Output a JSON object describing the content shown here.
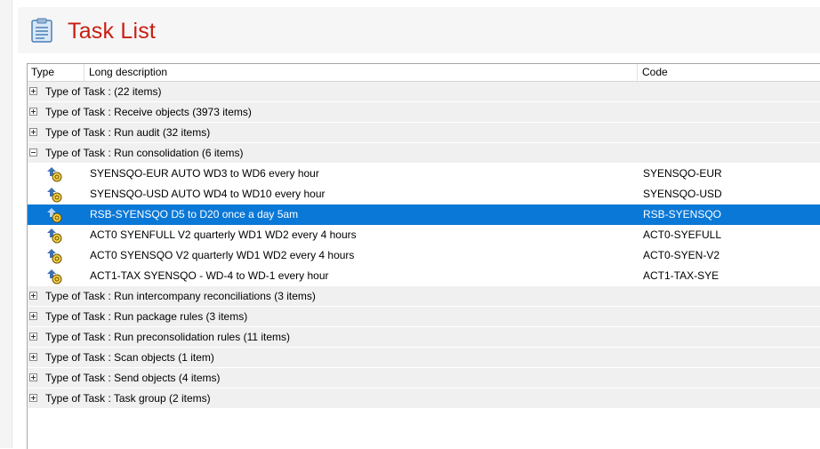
{
  "window": {
    "title": "Task List",
    "corner_mark": "`"
  },
  "icons": {
    "title_icon": "clipboard-list-icon",
    "task_icon": "scheduled-task-icon",
    "expand_icon": "expand-plus-icon",
    "collapse_icon": "collapse-minus-icon"
  },
  "colors": {
    "title_red": "#c81e12",
    "selection_blue": "#0a78d7",
    "group_row_bg": "#f0f0f0"
  },
  "table": {
    "columns": {
      "type": "Type",
      "description": "Long description",
      "code": "Code"
    },
    "groups": [
      {
        "label": "Type of Task :  (22 items)",
        "expanded": false
      },
      {
        "label": "Type of Task : Receive objects (3973 items)",
        "expanded": false
      },
      {
        "label": "Type of Task : Run audit (32 items)",
        "expanded": false
      },
      {
        "label": "Type of Task : Run consolidation (6 items)",
        "expanded": true
      },
      {
        "label": "Type of Task : Run intercompany reconciliations (3 items)",
        "expanded": false
      },
      {
        "label": "Type of Task : Run package rules (3 items)",
        "expanded": false
      },
      {
        "label": "Type of Task : Run preconsolidation rules (11 items)",
        "expanded": false
      },
      {
        "label": "Type of Task : Scan objects (1 item)",
        "expanded": false
      },
      {
        "label": "Type of Task : Send objects (4 items)",
        "expanded": false
      },
      {
        "label": "Type of Task : Task group (2 items)",
        "expanded": false
      }
    ],
    "consolidation_items": [
      {
        "description": "SYENSQO-EUR AUTO WD3 to WD6 every hour",
        "code": "SYENSQO-EUR",
        "selected": false
      },
      {
        "description": "SYENSQO-USD AUTO WD4 to WD10 every hour",
        "code": "SYENSQO-USD",
        "selected": false
      },
      {
        "description": "RSB-SYENSQO D5 to D20 once a day 5am",
        "code": "RSB-SYENSQO",
        "selected": true
      },
      {
        "description": "ACT0 SYENFULL V2 quarterly WD1 WD2 every 4 hours",
        "code": "ACT0-SYEFULL",
        "selected": false
      },
      {
        "description": "ACT0 SYENSQO  V2 quarterly WD1 WD2 every 4 hours",
        "code": "ACT0-SYEN-V2",
        "selected": false
      },
      {
        "description": "ACT1-TAX SYENSQO - WD-4 to WD-1 every hour",
        "code": "ACT1-TAX-SYE",
        "selected": false
      }
    ]
  }
}
